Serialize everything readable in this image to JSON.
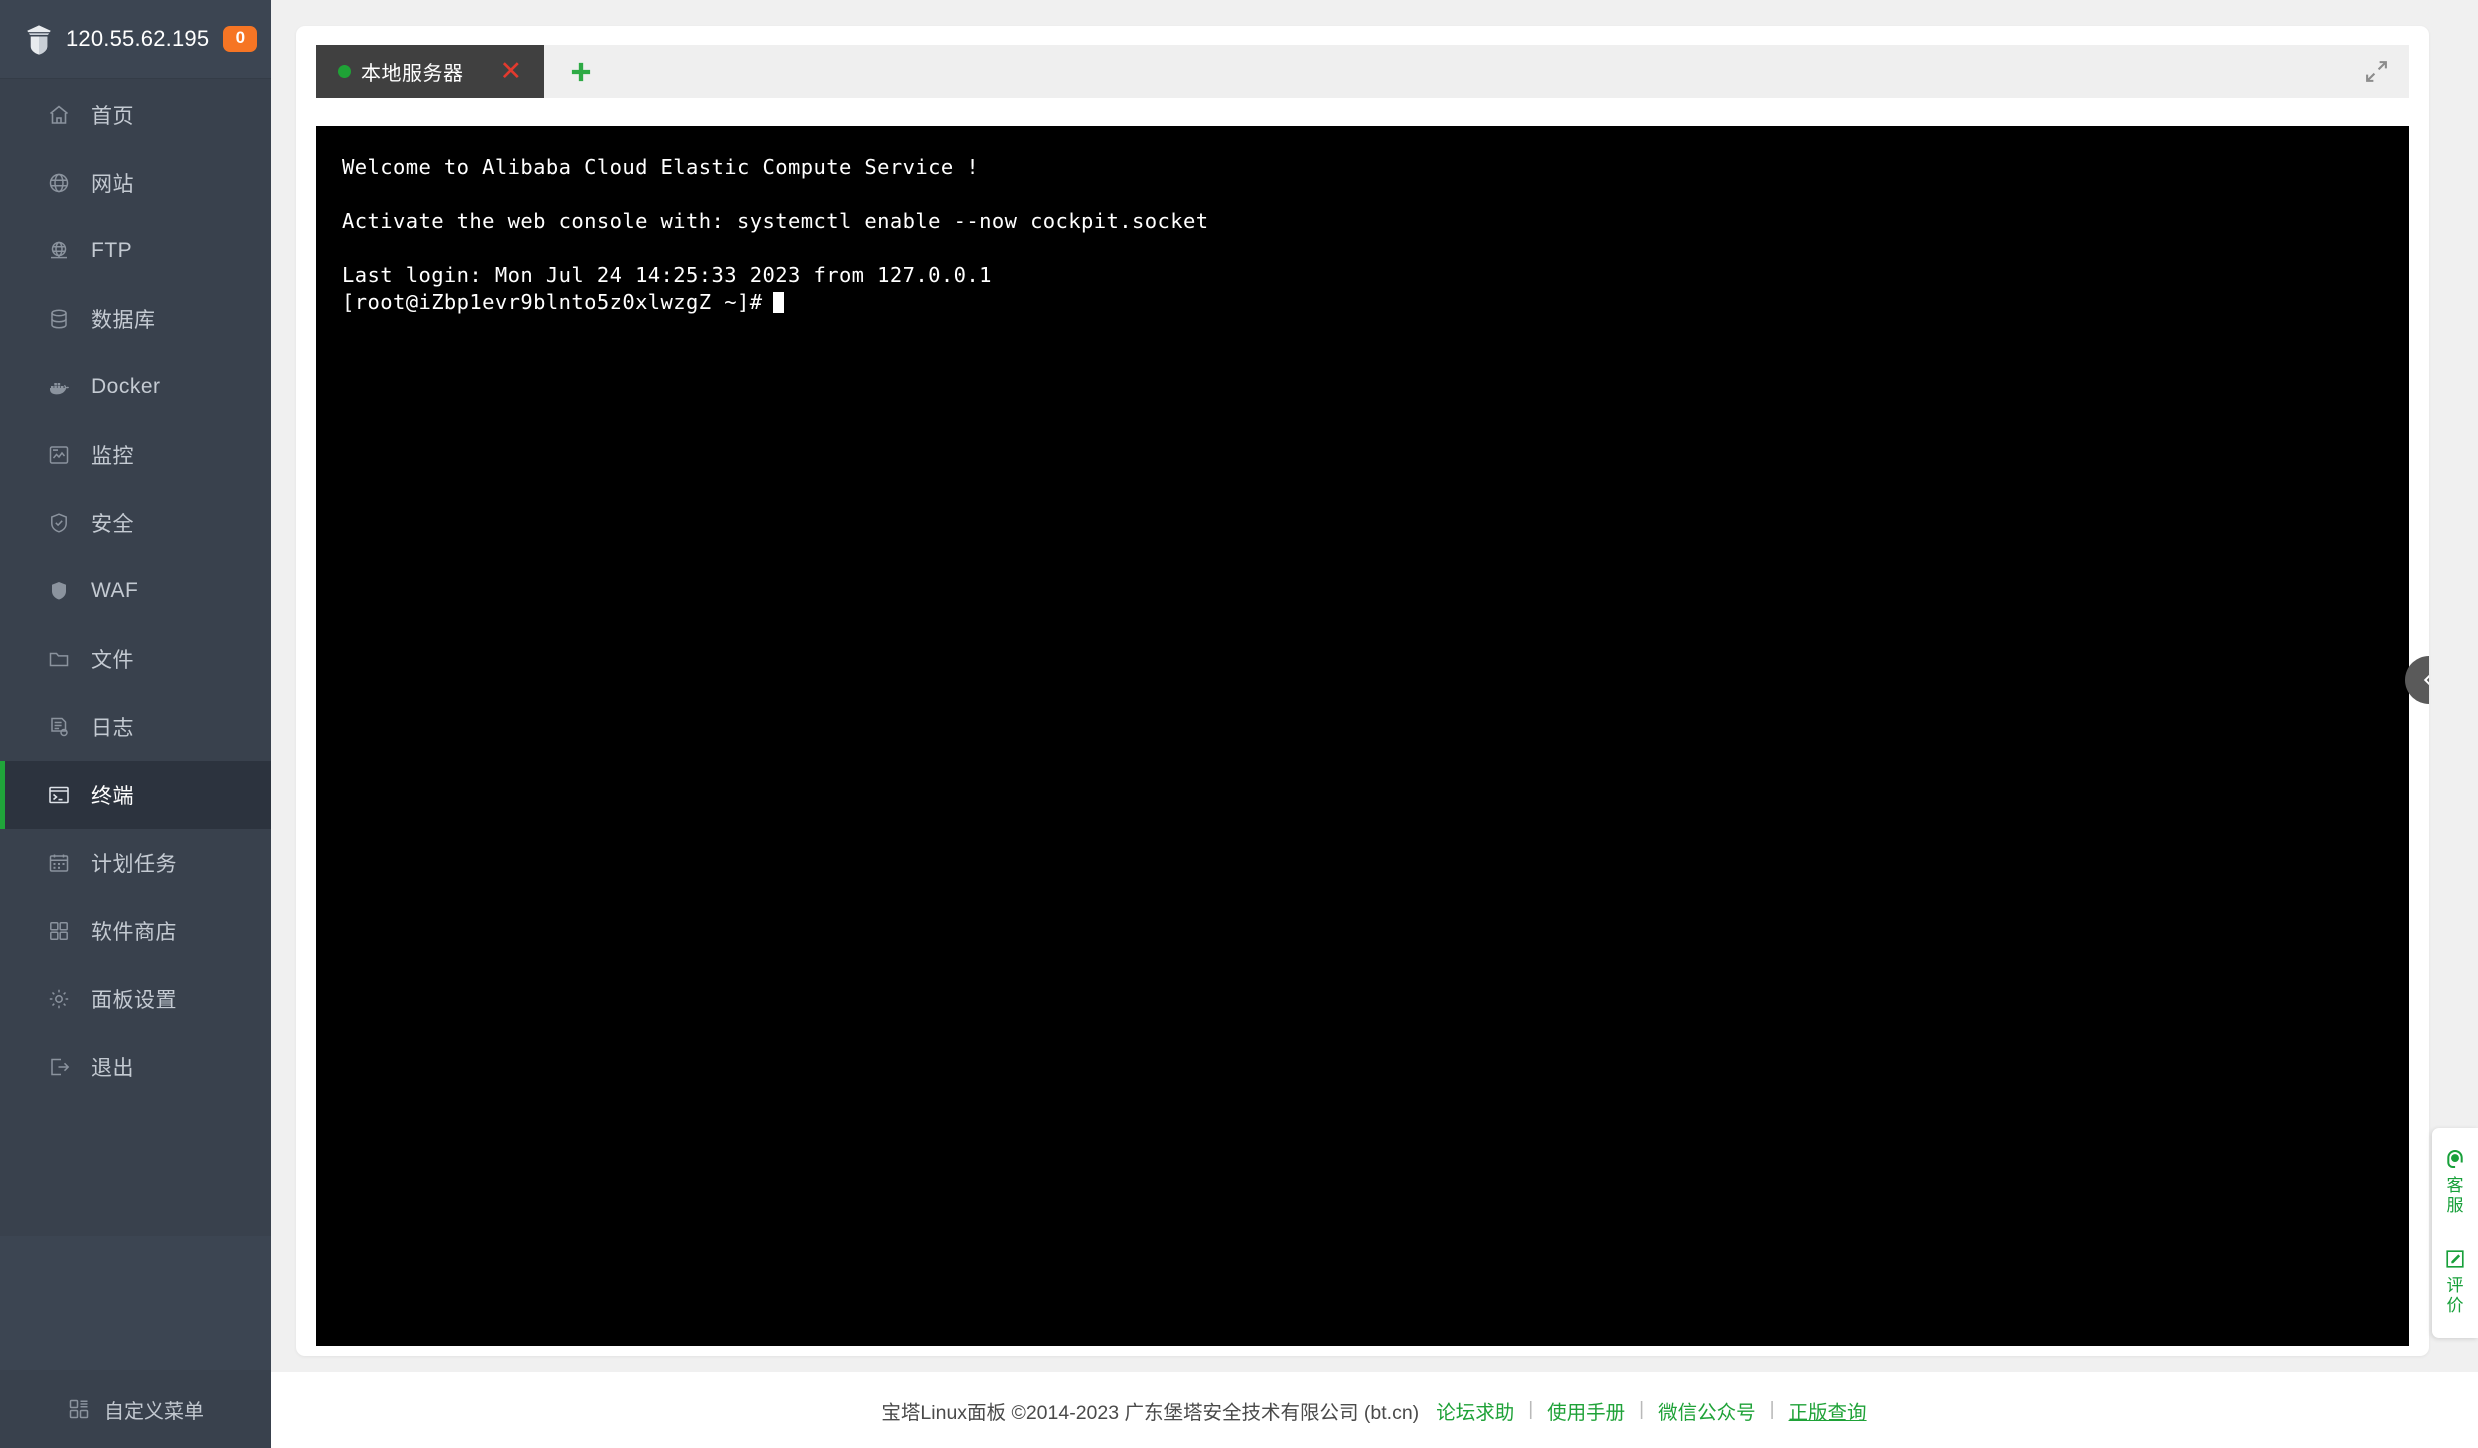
{
  "sidebar": {
    "logo_icon": "pagoda-logo-icon",
    "ip": "120.55.62.195",
    "notification_count": "0",
    "items": [
      {
        "label": "首页",
        "icon": "home-icon",
        "active": false
      },
      {
        "label": "网站",
        "icon": "globe-icon",
        "active": false
      },
      {
        "label": "FTP",
        "icon": "ftp-icon",
        "active": false
      },
      {
        "label": "数据库",
        "icon": "database-icon",
        "active": false
      },
      {
        "label": "Docker",
        "icon": "docker-icon",
        "active": false
      },
      {
        "label": "监控",
        "icon": "monitor-icon",
        "active": false
      },
      {
        "label": "安全",
        "icon": "shield-check-icon",
        "active": false
      },
      {
        "label": "WAF",
        "icon": "shield-icon",
        "active": false
      },
      {
        "label": "文件",
        "icon": "folder-icon",
        "active": false
      },
      {
        "label": "日志",
        "icon": "log-icon",
        "active": false
      },
      {
        "label": "终端",
        "icon": "terminal-icon",
        "active": true
      },
      {
        "label": "计划任务",
        "icon": "calendar-icon",
        "active": false
      },
      {
        "label": "软件商店",
        "icon": "apps-icon",
        "active": false
      },
      {
        "label": "面板设置",
        "icon": "gear-icon",
        "active": false
      },
      {
        "label": "退出",
        "icon": "logout-icon",
        "active": false
      }
    ],
    "custom_menu": {
      "label": "自定义菜单",
      "icon": "custom-menu-icon"
    }
  },
  "terminal_panel": {
    "tabs": [
      {
        "label": "本地服务器",
        "status": "connected",
        "close_glyph": "✕"
      }
    ],
    "add_tab_icon": "plus-icon",
    "fullscreen_icon": "expand-icon",
    "collapse_icon": "chevron-left-icon",
    "console": {
      "line1": "Welcome to Alibaba Cloud Elastic Compute Service !",
      "line2": "Activate the web console with: systemctl enable --now cockpit.socket",
      "line3": "Last login: Mon Jul 24 14:25:33 2023 from 127.0.0.1",
      "prompt": "[root@iZbp1evr9blnto5z0xlwzgZ ~]#"
    }
  },
  "side_widget": {
    "items": [
      {
        "label": "客服",
        "icon": "headset-icon"
      },
      {
        "label": "评价",
        "icon": "edit-square-icon"
      }
    ]
  },
  "footer": {
    "copyright": "宝塔Linux面板 ©2014-2023 广东堡塔安全技术有限公司 (bt.cn)",
    "links": [
      {
        "label": "论坛求助",
        "underlined": false
      },
      {
        "label": "使用手册",
        "underlined": false
      },
      {
        "label": "微信公众号",
        "underlined": false
      },
      {
        "label": "正版查询",
        "underlined": true
      }
    ],
    "separator": "|"
  },
  "colors": {
    "sidebar_bg": "#39414d",
    "sidebar_header_bg": "#3c4552",
    "active_item_bg": "#2c333e",
    "accent_green": "#20a53a",
    "badge_orange": "#f67524",
    "terminal_bg": "#000000",
    "page_bg": "#f0f0f0",
    "tab_active_bg": "#404040",
    "close_red": "#e23a2e"
  }
}
